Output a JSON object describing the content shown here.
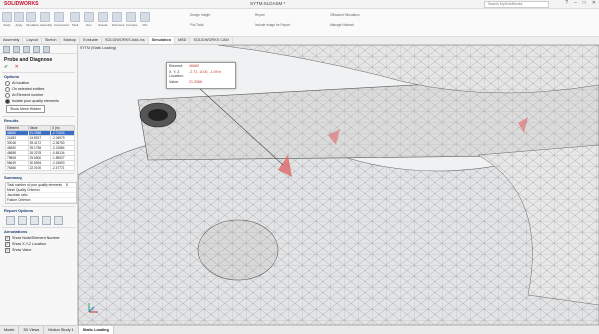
{
  "titlebar": {
    "logo": "SOLIDWORKS",
    "doc_title": "SYTM.SLDASM *",
    "search_placeholder": "Search MySolidWorks",
    "controls": [
      "?",
      "–",
      "□",
      "✕"
    ]
  },
  "ribbon": {
    "buttons": [
      "Study",
      "Apply",
      "Simulation",
      "Assembly",
      "Connections",
      "Shell",
      "Run",
      "Results",
      "Deformed",
      "Compare",
      "Plot"
    ],
    "small_items": [
      "Design Insight",
      "Plot Tools",
      "Report",
      "Include Image for Report",
      "Offloaded Simulation",
      "Manage Network"
    ]
  },
  "tabs": [
    "Assembly",
    "Layout",
    "Sketch",
    "Markup",
    "Evaluate",
    "SOLIDWORKS Add-Ins",
    "Simulation",
    "MBD",
    "SOLIDWORKS CAM"
  ],
  "active_tab": "Simulation",
  "panel": {
    "title": "Probe and Diagnose",
    "ok": "✔",
    "cancel": "✕",
    "options_head": "Options",
    "options": [
      "At location",
      "On selected entities",
      "At Element number",
      "Isolate poor quality elements"
    ],
    "selected_option": "Isolate poor quality elements",
    "mesh_button": "Show Mesh Hidden",
    "results_head": "Results",
    "results_columns": [
      "Element",
      "Value",
      "X (in)"
    ],
    "results_rows": [
      [
        "46660",
        "21.2968",
        "-2.71024"
      ],
      [
        "24483",
        "24.8917",
        "-2.04979"
      ],
      [
        "30048",
        "39.4172",
        "-2.36750"
      ],
      [
        "46650",
        "39.1756",
        "-2.21584"
      ],
      [
        "48688",
        "26.3278",
        "-0.65134"
      ],
      [
        "79808",
        "25.6500",
        "-1.89927"
      ],
      [
        "56649",
        "30.8594",
        "-2.24500"
      ],
      [
        "76466",
        "22.0100",
        "-2.47771"
      ]
    ],
    "summary_head": "Summary",
    "summary_rows": [
      [
        "Total number of poor quality elements",
        "8"
      ],
      [
        "Mesh Quality Criterion",
        ""
      ],
      [
        "Jacobian ratio",
        ""
      ],
      [
        "Failure Criterion",
        ""
      ]
    ],
    "report_head": "Report Options",
    "annotations_head": "Annotations",
    "annotations": [
      "Show Node/Element Number",
      "Show X,Y,Z Location",
      "Show Value"
    ]
  },
  "viewport": {
    "tree_label": "SYTM (Static Loading)",
    "probe": {
      "element_label": "Element:",
      "element_value": "46660",
      "location_label": "X, Y, Z Location:",
      "location_value": "-2.71, -8.00, -1.09 in",
      "value_label": "Value:",
      "value_value": "21.2968"
    }
  },
  "bottom_tabs": [
    "Model",
    "3D Views",
    "Motion Study 1",
    "Static Loading"
  ],
  "active_bottom_tab": "Static Loading"
}
